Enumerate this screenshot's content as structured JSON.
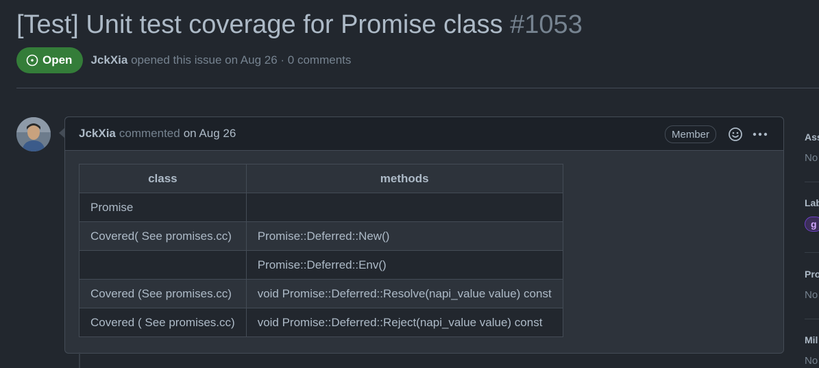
{
  "issue": {
    "title": "[Test] Unit test coverage for Promise class",
    "number": "#1053",
    "state": "Open",
    "author": "JckXia",
    "meta_text": "opened this issue on Aug 26 · 0 comments"
  },
  "comment": {
    "author": "JckXia",
    "action": "commented",
    "date": "on Aug 26",
    "role_badge": "Member",
    "table": {
      "headers": [
        "class",
        "methods"
      ],
      "rows": [
        [
          "Promise",
          ""
        ],
        [
          "Covered( See promises.cc)",
          "Promise::Deferred::New()"
        ],
        [
          "",
          "Promise::Deferred::Env()"
        ],
        [
          "Covered (See promises.cc)",
          "void Promise::Deferred::Resolve(napi_value value) const"
        ],
        [
          "Covered ( See promises.cc)",
          "void Promise::Deferred::Reject(napi_value value) const"
        ]
      ]
    }
  },
  "sidebar": {
    "assignees": {
      "heading": "Ass",
      "value": "No"
    },
    "labels": {
      "heading": "Lab",
      "chip": "g"
    },
    "projects": {
      "heading": "Pro",
      "value": "No"
    },
    "milestone": {
      "heading": "Mil",
      "value": "No"
    }
  },
  "icons": {
    "state_icon": "issue-opened-icon",
    "reaction_icon": "smiley-icon",
    "menu_icon": "kebab-horizontal-icon"
  },
  "colors": {
    "open_badge": "#347d39",
    "background": "#22272e",
    "text": "#adbac7",
    "muted": "#768390",
    "border": "#444c56"
  }
}
